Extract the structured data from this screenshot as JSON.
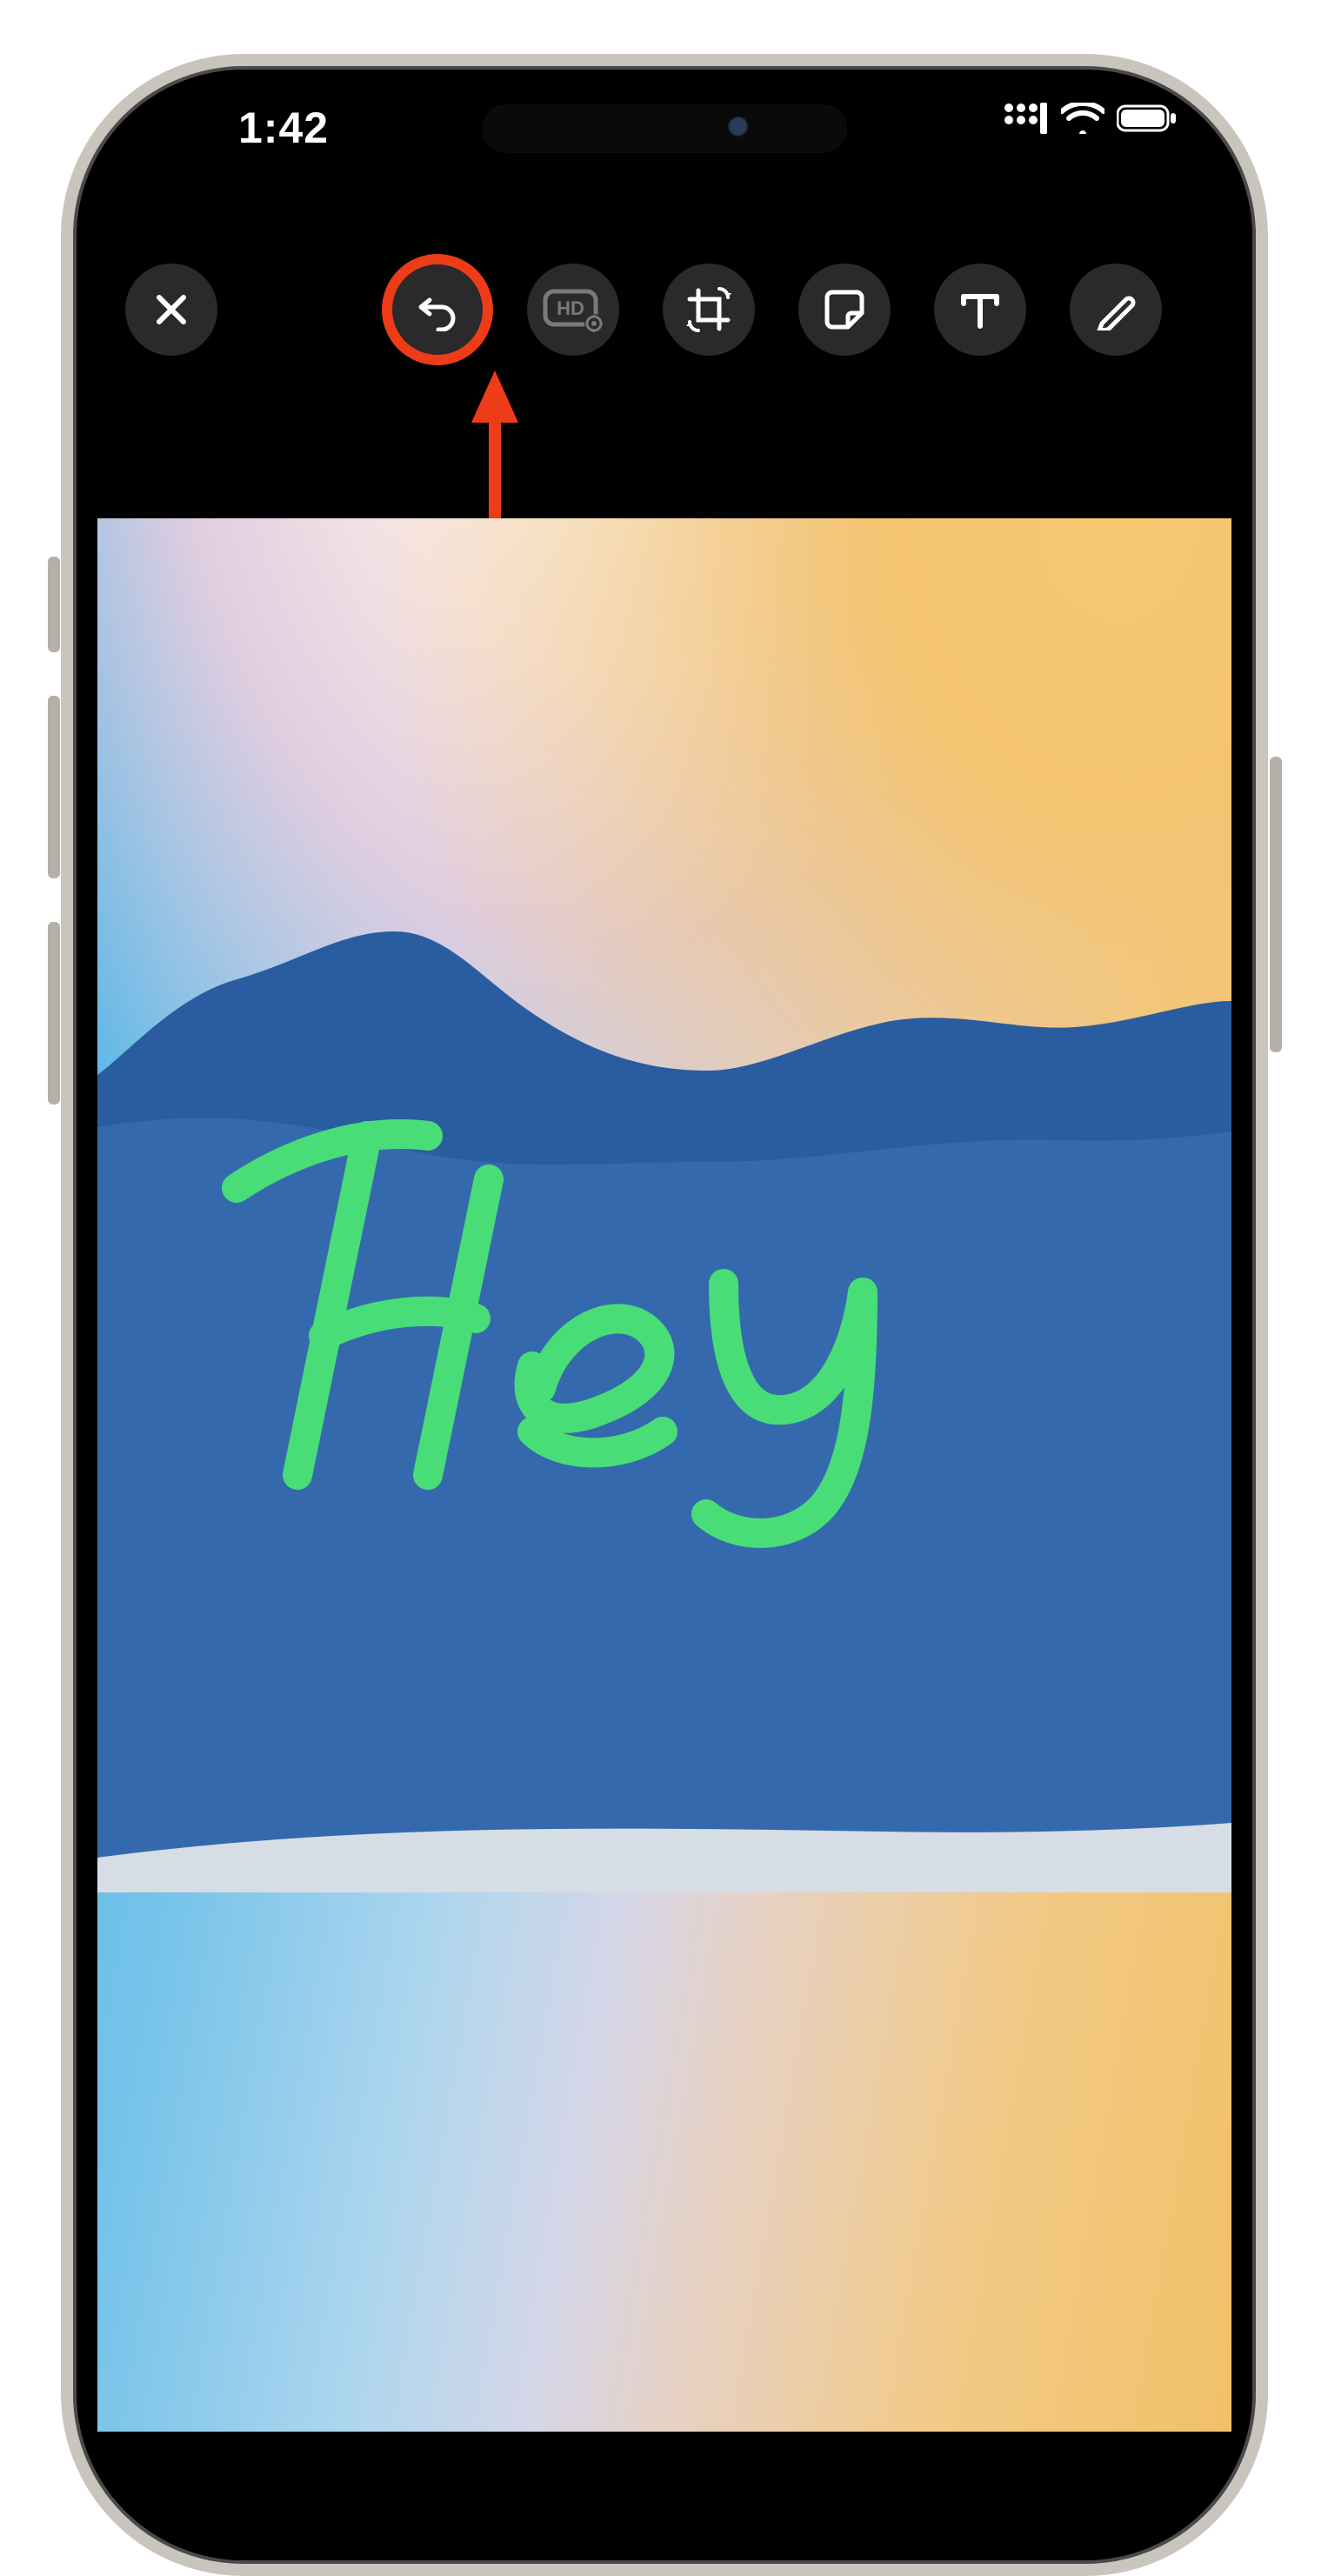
{
  "status": {
    "time": "1:42"
  },
  "toolbar": {
    "hd_label": "HD"
  },
  "canvas": {
    "drawing_text": "Hey"
  },
  "annotation": {
    "highlight_target": "undo-button",
    "highlight_color": "#ee3b18"
  },
  "colors": {
    "drawing_stroke": "#49dd77",
    "mountain": "#2a5da0"
  }
}
